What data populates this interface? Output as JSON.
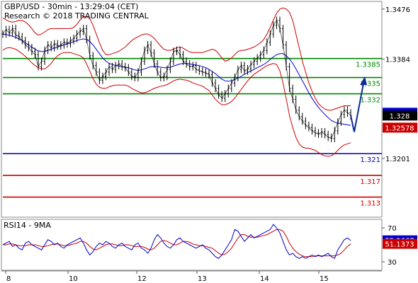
{
  "header": {
    "line1": "GBP/USD - 30min - 13:29:04 (CET)",
    "line2": "Research © 2018 TRADING CENTRAL"
  },
  "rsi_label": "RSI14 - 9MA",
  "colors": {
    "price": "#000000",
    "bollinger": "#cc0000",
    "ma": "#0000cc",
    "resistance": "#008800",
    "support_blue": "#0000aa",
    "support_red": "#cc0000",
    "arrow": "#0a2a99",
    "rsi": "#0000cc",
    "rsi_ma": "#cc0000",
    "current_tag": "#000000",
    "upper_tag": "#0000cc",
    "lower_tag": "#cc0000"
  },
  "chart_data": {
    "type": "line",
    "title": "GBP/USD - 30min - 13:29:04 (CET)",
    "x_ticks": [
      "8",
      "10",
      "12",
      "13",
      "14",
      "15"
    ],
    "y_ticks": [
      1.3476,
      1.3384,
      1.3201
    ],
    "ylim": [
      1.3093,
      1.349
    ],
    "price_levels": [
      {
        "name": "resistance-3",
        "label": "1.3385",
        "value": 1.3385,
        "color": "green"
      },
      {
        "name": "resistance-2",
        "label": "1.335",
        "value": 1.335,
        "color": "green"
      },
      {
        "name": "resistance-1",
        "label": "1.332",
        "value": 1.332,
        "color": "green"
      },
      {
        "name": "support-1",
        "label": "1.321",
        "value": 1.321,
        "color": "blue"
      },
      {
        "name": "support-2",
        "label": "1.317",
        "value": 1.317,
        "color": "red"
      },
      {
        "name": "support-3",
        "label": "1.313",
        "value": 1.313,
        "color": "red"
      }
    ],
    "tags": [
      {
        "name": "upper-band-tag",
        "label": "1.32852",
        "value": 1.32852
      },
      {
        "name": "current-price-tag",
        "label": "1.328",
        "value": 1.328
      },
      {
        "name": "lower-band-tag",
        "label": "1.32578",
        "value": 1.32578
      }
    ],
    "price": [
      1.343,
      1.3438,
      1.3432,
      1.344,
      1.3428,
      1.3425,
      1.3418,
      1.341,
      1.3405,
      1.3398,
      1.3392,
      1.337,
      1.338,
      1.34,
      1.341,
      1.3405,
      1.3412,
      1.3408,
      1.341,
      1.3415,
      1.3412,
      1.3418,
      1.3422,
      1.343,
      1.3435,
      1.344,
      1.342,
      1.339,
      1.3372,
      1.336,
      1.3345,
      1.3352,
      1.336,
      1.337,
      1.3365,
      1.3372,
      1.3375,
      1.337,
      1.3368,
      1.336,
      1.3352,
      1.335,
      1.336,
      1.338,
      1.34,
      1.341,
      1.3395,
      1.3375,
      1.336,
      1.335,
      1.3352,
      1.3365,
      1.338,
      1.3398,
      1.34,
      1.3392,
      1.338,
      1.3375,
      1.337,
      1.3372,
      1.3365,
      1.3362,
      1.336,
      1.3358,
      1.3355,
      1.334,
      1.333,
      1.3318,
      1.3312,
      1.332,
      1.333,
      1.334,
      1.335,
      1.3365,
      1.3372,
      1.3362,
      1.3366,
      1.3374,
      1.338,
      1.3386,
      1.3392,
      1.34,
      1.3415,
      1.343,
      1.3446,
      1.3455,
      1.344,
      1.341,
      1.337,
      1.333,
      1.331,
      1.329,
      1.3278,
      1.327,
      1.3262,
      1.3258,
      1.3252,
      1.3248,
      1.3246,
      1.325,
      1.3245,
      1.324,
      1.3238,
      1.3252,
      1.3268,
      1.3282,
      1.329,
      1.3285,
      1.328
    ],
    "bb_upper": [
      1.346,
      1.3456,
      1.3453,
      1.3452,
      1.3453,
      1.3455,
      1.3455,
      1.3452,
      1.3447,
      1.344,
      1.3432,
      1.3428,
      1.343,
      1.3434,
      1.3438,
      1.344,
      1.344,
      1.344,
      1.344,
      1.344,
      1.344,
      1.344,
      1.3442,
      1.3448,
      1.3456,
      1.3462,
      1.3462,
      1.3458,
      1.3446,
      1.343,
      1.3414,
      1.34,
      1.3392,
      1.3392,
      1.3394,
      1.3396,
      1.3398,
      1.3402,
      1.3406,
      1.3412,
      1.3418,
      1.3422,
      1.3425,
      1.3428,
      1.343,
      1.343,
      1.3427,
      1.3422,
      1.3415,
      1.3408,
      1.3402,
      1.34,
      1.34,
      1.3402,
      1.3405,
      1.3406,
      1.3404,
      1.34,
      1.3397,
      1.3396,
      1.3396,
      1.3396,
      1.3396,
      1.3398,
      1.34,
      1.3402,
      1.34,
      1.3394,
      1.3386,
      1.338,
      1.3382,
      1.3386,
      1.3392,
      1.3398,
      1.34,
      1.34,
      1.3402,
      1.3404,
      1.3406,
      1.341,
      1.3414,
      1.342,
      1.343,
      1.3442,
      1.3456,
      1.3468,
      1.3476,
      1.3478,
      1.3476,
      1.347,
      1.3455,
      1.343,
      1.3405,
      1.338,
      1.336,
      1.334,
      1.3325,
      1.3312,
      1.3302,
      1.3296,
      1.3292,
      1.329,
      1.329,
      1.3292,
      1.3294,
      1.3296,
      1.3298,
      1.3298,
      1.3298
    ],
    "bb_lower": [
      1.34,
      1.3404,
      1.3405,
      1.3404,
      1.3402,
      1.3398,
      1.3394,
      1.3389,
      1.3383,
      1.3377,
      1.3372,
      1.3368,
      1.3366,
      1.3366,
      1.337,
      1.3376,
      1.3384,
      1.339,
      1.3394,
      1.3396,
      1.3396,
      1.3396,
      1.3394,
      1.3392,
      1.339,
      1.3386,
      1.3375,
      1.3362,
      1.3348,
      1.3338,
      1.3332,
      1.333,
      1.333,
      1.3333,
      1.3335,
      1.3336,
      1.3336,
      1.3336,
      1.3336,
      1.3334,
      1.333,
      1.3327,
      1.3324,
      1.3322,
      1.3322,
      1.3324,
      1.3327,
      1.333,
      1.3332,
      1.3334,
      1.3335,
      1.3337,
      1.334,
      1.3344,
      1.3346,
      1.3347,
      1.3346,
      1.3345,
      1.3343,
      1.334,
      1.3338,
      1.3336,
      1.3334,
      1.333,
      1.3326,
      1.3318,
      1.331,
      1.3304,
      1.33,
      1.33,
      1.3302,
      1.3306,
      1.3312,
      1.332,
      1.3328,
      1.3336,
      1.3344,
      1.335,
      1.3356,
      1.336,
      1.3364,
      1.3368,
      1.3372,
      1.3374,
      1.3376,
      1.3374,
      1.3362,
      1.334,
      1.331,
      1.328,
      1.3258,
      1.324,
      1.3228,
      1.3222,
      1.322,
      1.322,
      1.3218,
      1.3216,
      1.3212,
      1.3208,
      1.3206,
      1.3205,
      1.3206,
      1.321,
      1.3216,
      1.3222,
      1.3226,
      1.3228,
      1.323
    ],
    "ma": [
      1.343,
      1.3429,
      1.3428,
      1.3426,
      1.3424,
      1.3421,
      1.3418,
      1.3414,
      1.341,
      1.3406,
      1.3402,
      1.3399,
      1.3398,
      1.3398,
      1.34,
      1.3402,
      1.3404,
      1.3406,
      1.3408,
      1.341,
      1.3412,
      1.3414,
      1.3416,
      1.3418,
      1.342,
      1.3421,
      1.342,
      1.3416,
      1.341,
      1.3402,
      1.3394,
      1.3386,
      1.338,
      1.3376,
      1.3374,
      1.3372,
      1.3371,
      1.337,
      1.3369,
      1.3368,
      1.3366,
      1.3364,
      1.3363,
      1.3364,
      1.3366,
      1.3368,
      1.337,
      1.337,
      1.337,
      1.3369,
      1.3368,
      1.3368,
      1.3369,
      1.3371,
      1.3373,
      1.3375,
      1.3376,
      1.3376,
      1.3375,
      1.3374,
      1.3373,
      1.3372,
      1.337,
      1.3368,
      1.3365,
      1.3361,
      1.3357,
      1.3352,
      1.3347,
      1.3344,
      1.3343,
      1.3344,
      1.3346,
      1.3349,
      1.3352,
      1.3356,
      1.3359,
      1.3362,
      1.3365,
      1.3368,
      1.3371,
      1.3374,
      1.3378,
      1.3383,
      1.3388,
      1.3392,
      1.3394,
      1.3394,
      1.339,
      1.3384,
      1.3376,
      1.3366,
      1.3355,
      1.3344,
      1.3333,
      1.3322,
      1.3312,
      1.3303,
      1.3295,
      1.3288,
      1.3282,
      1.3276,
      1.3271,
      1.3268,
      1.3266,
      1.3265,
      1.3264,
      1.3263,
      1.3262
    ],
    "rsi": {
      "label": "RSI14 - 9MA",
      "y_ticks": [
        70,
        50,
        30
      ],
      "ylim": [
        20,
        80
      ],
      "tags": [
        {
          "name": "rsi-value-tag",
          "label": "55.2667",
          "value": 55.2667
        },
        {
          "name": "rsi-ma-tag",
          "label": "51.1373",
          "value": 51.1373
        }
      ],
      "values": [
        50,
        52,
        54,
        48,
        50,
        46,
        44,
        52,
        54,
        50,
        48,
        46,
        44,
        50,
        56,
        54,
        50,
        52,
        48,
        46,
        50,
        52,
        54,
        56,
        58,
        52,
        44,
        38,
        42,
        48,
        52,
        50,
        54,
        52,
        48,
        46,
        50,
        52,
        48,
        46,
        44,
        50,
        52,
        46,
        44,
        40,
        46,
        56,
        62,
        58,
        52,
        48,
        46,
        50,
        56,
        58,
        54,
        52,
        50,
        48,
        46,
        48,
        50,
        46,
        44,
        40,
        36,
        34,
        38,
        44,
        50,
        56,
        68,
        66,
        60,
        54,
        58,
        62,
        58,
        60,
        62,
        64,
        66,
        68,
        74,
        70,
        64,
        54,
        44,
        38,
        40,
        36,
        34,
        36,
        34,
        36,
        38,
        36,
        38,
        36,
        38,
        40,
        36,
        34,
        44,
        50,
        56,
        58,
        55
      ],
      "ma": [
        50,
        50,
        51,
        51,
        50,
        49,
        49,
        49,
        50,
        50,
        50,
        49,
        48,
        48,
        49,
        50,
        51,
        51,
        50,
        49,
        49,
        50,
        51,
        52,
        54,
        54,
        52,
        48,
        45,
        44,
        46,
        48,
        50,
        51,
        51,
        50,
        49,
        49,
        50,
        50,
        49,
        48,
        48,
        48,
        47,
        45,
        44,
        46,
        50,
        54,
        55,
        54,
        52,
        50,
        50,
        52,
        54,
        54,
        53,
        51,
        50,
        49,
        49,
        48,
        47,
        46,
        43,
        40,
        38,
        39,
        42,
        46,
        52,
        58,
        62,
        62,
        60,
        59,
        59,
        59,
        60,
        61,
        62,
        64,
        66,
        68,
        68,
        66,
        60,
        52,
        46,
        42,
        39,
        37,
        36,
        36,
        36,
        37,
        37,
        37,
        37,
        37,
        37,
        37,
        38,
        40,
        44,
        48,
        51
      ]
    }
  }
}
